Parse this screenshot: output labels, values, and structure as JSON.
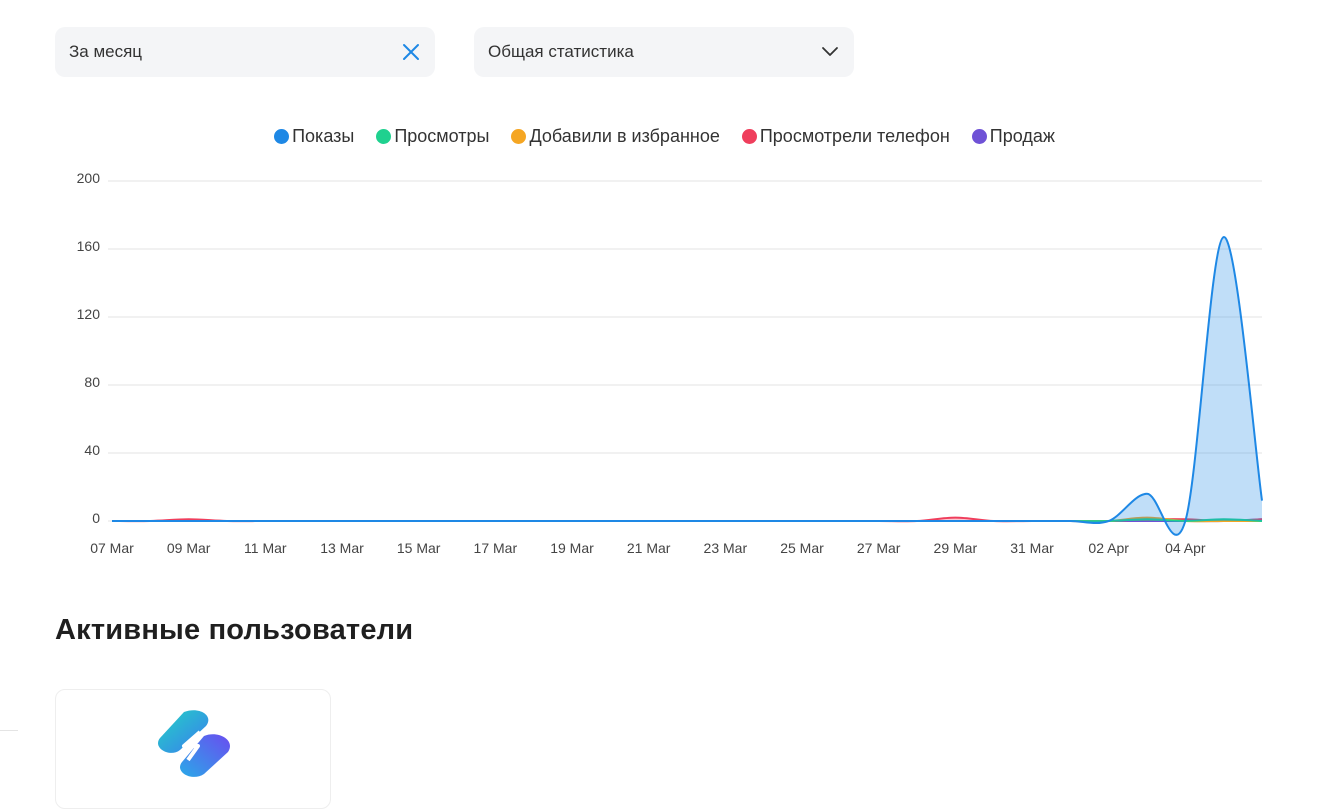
{
  "filters": {
    "period_value": "За месяц",
    "mode_value": "Общая статистика"
  },
  "section": {
    "title": "Активные пользователи"
  },
  "colors": {
    "accent": "#1e88e5",
    "clear_icon": "#1e88e5",
    "filter_bg": "#f4f5f7"
  },
  "icons": {
    "clear": "close-icon",
    "dropdown": "chevron-down-icon"
  },
  "chart_data": {
    "type": "area",
    "ylim": [
      0,
      200
    ],
    "yticks": [
      0,
      40,
      80,
      120,
      160,
      200
    ],
    "grid": true,
    "legend_position": "top-center",
    "x": [
      "07 Mar",
      "08 Mar",
      "09 Mar",
      "10 Mar",
      "11 Mar",
      "12 Mar",
      "13 Mar",
      "14 Mar",
      "15 Mar",
      "16 Mar",
      "17 Mar",
      "18 Mar",
      "19 Mar",
      "20 Mar",
      "21 Mar",
      "22 Mar",
      "23 Mar",
      "24 Mar",
      "25 Mar",
      "26 Mar",
      "27 Mar",
      "28 Mar",
      "29 Mar",
      "30 Mar",
      "31 Mar",
      "01 Apr",
      "02 Apr",
      "03 Apr",
      "04 Apr",
      "05 Apr",
      "06 Apr"
    ],
    "xtick_labels": [
      "07 Mar",
      "09 Mar",
      "11 Mar",
      "13 Mar",
      "15 Mar",
      "17 Mar",
      "19 Mar",
      "21 Mar",
      "23 Mar",
      "25 Mar",
      "27 Mar",
      "29 Mar",
      "31 Mar",
      "02 Apr",
      "04 Apr"
    ],
    "series": [
      {
        "name": "Показы",
        "color": "#1e88e5",
        "values": [
          0,
          0,
          0,
          0,
          0,
          0,
          0,
          0,
          0,
          0,
          0,
          0,
          0,
          0,
          0,
          0,
          0,
          0,
          0,
          0,
          0,
          0,
          0,
          0,
          0,
          0,
          0,
          16,
          0,
          167,
          12
        ]
      },
      {
        "name": "Просмотры",
        "color": "#1fd18f",
        "values": [
          0,
          0,
          0,
          0,
          0,
          0,
          0,
          0,
          0,
          0,
          0,
          0,
          0,
          0,
          0,
          0,
          0,
          0,
          0,
          0,
          0,
          0,
          0,
          0,
          0,
          0,
          0,
          1,
          0,
          1,
          0
        ]
      },
      {
        "name": "Добавили в избранное",
        "color": "#f5a623",
        "values": [
          0,
          0,
          0,
          0,
          0,
          0,
          0,
          0,
          0,
          0,
          0,
          0,
          0,
          0,
          0,
          0,
          0,
          0,
          0,
          0,
          0,
          0,
          0,
          0,
          0,
          0,
          0,
          2,
          0,
          0,
          0
        ]
      },
      {
        "name": "Просмотрели телефон",
        "color": "#ef3e5c",
        "values": [
          0,
          0,
          1,
          0,
          0,
          0,
          0,
          0,
          0,
          0,
          0,
          0,
          0,
          0,
          0,
          0,
          0,
          0,
          0,
          0,
          0,
          0,
          2,
          0,
          0,
          0,
          0,
          1,
          1,
          0,
          1
        ]
      },
      {
        "name": "Продаж",
        "color": "#6f52d6",
        "values": [
          0,
          0,
          0,
          0,
          0,
          0,
          0,
          0,
          0,
          0,
          0,
          0,
          0,
          0,
          0,
          0,
          0,
          0,
          0,
          0,
          0,
          0,
          0,
          0,
          0,
          0,
          0,
          0,
          0,
          0,
          1
        ]
      }
    ]
  }
}
